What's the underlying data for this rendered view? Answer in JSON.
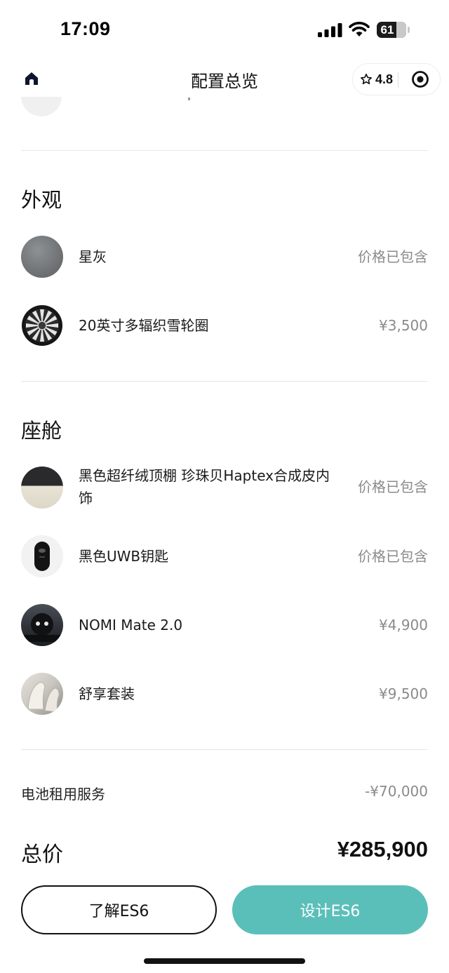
{
  "status_bar": {
    "time": "17:09",
    "battery_level": "61",
    "icons": [
      "cellular-signal-icon",
      "wifi-icon",
      "battery-icon"
    ]
  },
  "nav": {
    "title": "配置总览",
    "rating": "4.8",
    "icons": [
      "home-icon",
      "star-icon",
      "target-icon"
    ]
  },
  "exterior": {
    "title": "外观",
    "items": [
      {
        "name": "星灰",
        "price": "价格已包含",
        "thumb": "gray-paint-swatch"
      },
      {
        "name": "20英寸多辐织雪轮圈",
        "price": "¥3,500",
        "thumb": "wheel-rim"
      }
    ]
  },
  "cabin": {
    "title": "座舱",
    "items": [
      {
        "name_line1": "黑色超纤绒顶棚 珍珠贝Haptex合成皮内",
        "name_line2": "饰",
        "price": "价格已包含",
        "thumb": "interior-swatch"
      },
      {
        "name": "黑色UWB钥匙",
        "price": "价格已包含",
        "thumb": "uwb-key"
      },
      {
        "name": "NOMI Mate 2.0",
        "price": "¥4,900",
        "thumb": "nomi-robot"
      },
      {
        "name": "舒享套装",
        "price": "¥9,500",
        "thumb": "seat-package"
      }
    ]
  },
  "summary": {
    "battery_label": "电池租用服务",
    "battery_value": "-¥70,000",
    "total_label": "总价",
    "total_value": "¥285,900"
  },
  "buttons": {
    "learn": "了解ES6",
    "design": "设计ES6"
  },
  "colors": {
    "accent": "#5bbfb9",
    "text_primary": "#111111",
    "text_secondary": "#8a8a8a",
    "divider": "#e6e6e6"
  }
}
